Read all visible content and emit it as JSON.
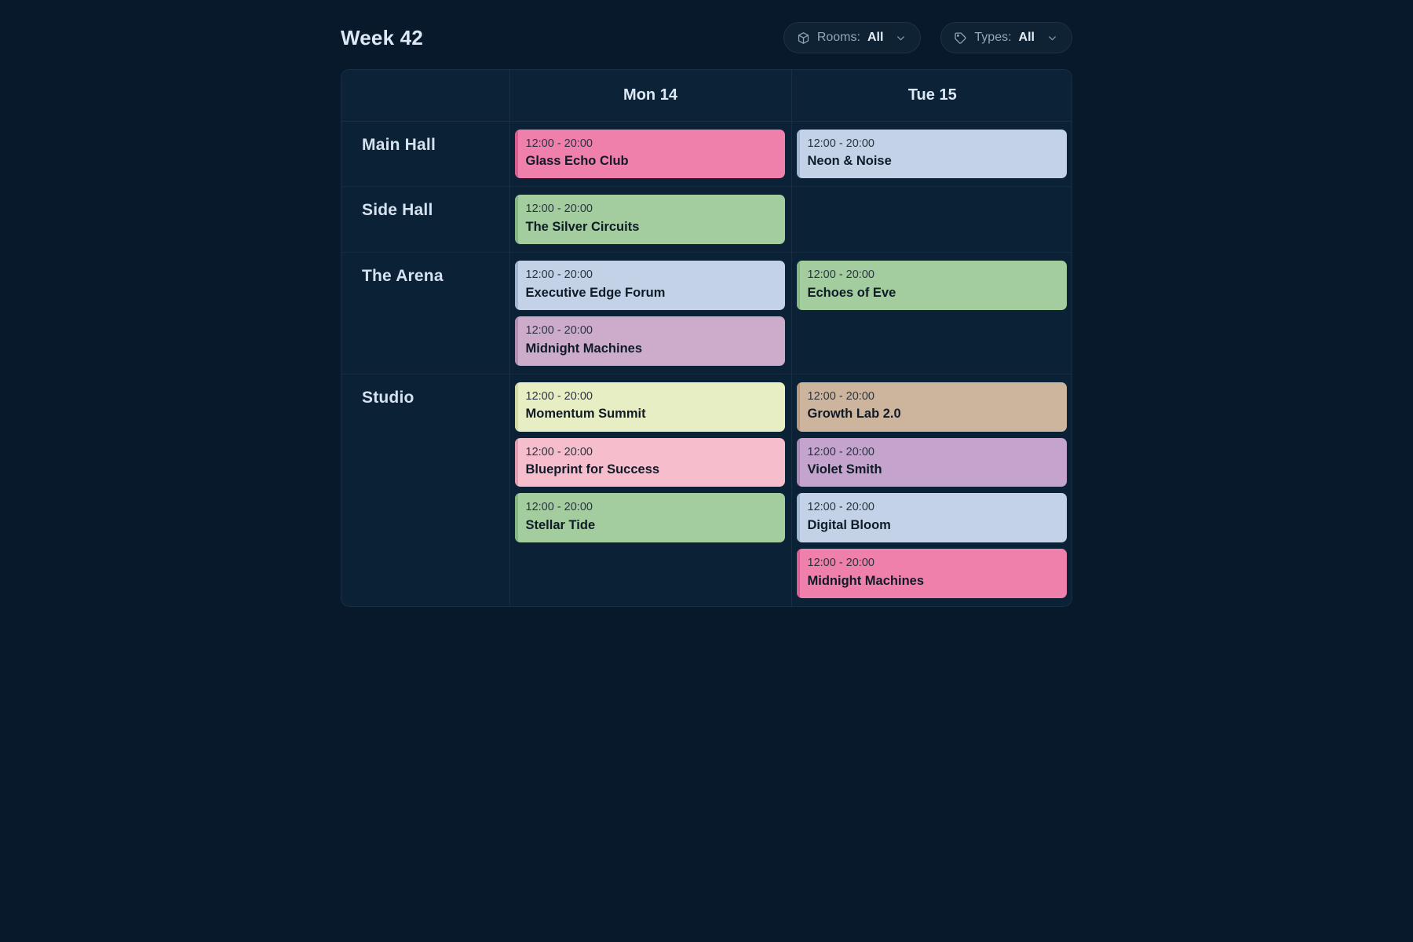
{
  "header": {
    "title": "Week 42",
    "filters": [
      {
        "icon": "cube-icon",
        "label": "Rooms:",
        "value": "All",
        "chevron": "chevron-down-icon"
      },
      {
        "icon": "tag-icon",
        "label": "Types:",
        "value": "All",
        "chevron": "chevron-down-icon"
      }
    ]
  },
  "schedule": {
    "columns": [
      "",
      "Mon 14",
      "Tue 15"
    ],
    "rows": [
      {
        "room": "Main Hall",
        "days": [
          [
            {
              "time": "12:00 - 20:00",
              "title": "Glass Echo Club",
              "color": "#ef7fab",
              "accent": "#d75f91"
            }
          ],
          [
            {
              "time": "12:00 - 20:00",
              "title": "Neon & Noise",
              "color": "#c3d2e6",
              "accent": "#a3b6d0"
            }
          ]
        ]
      },
      {
        "room": "Side Hall",
        "days": [
          [
            {
              "time": "12:00 - 20:00",
              "title": "The Silver Circuits",
              "color": "#a3cd9e",
              "accent": "#86b782"
            }
          ],
          []
        ]
      },
      {
        "room": "The Arena",
        "days": [
          [
            {
              "time": "12:00 - 20:00",
              "title": "Executive Edge Forum",
              "color": "#c3d2e6",
              "accent": "#a3b6d0"
            },
            {
              "time": "12:00 - 20:00",
              "title": "Midnight Machines",
              "color": "#ccabcb",
              "accent": "#b48fb4"
            }
          ],
          [
            {
              "time": "12:00 - 20:00",
              "title": "Echoes of Eve",
              "color": "#a3cd9e",
              "accent": "#86b782"
            }
          ]
        ]
      },
      {
        "room": "Studio",
        "days": [
          [
            {
              "time": "12:00 - 20:00",
              "title": "Momentum Summit",
              "color": "#e8eec4",
              "accent": "#d2dba4"
            },
            {
              "time": "12:00 - 20:00",
              "title": "Blueprint for Success",
              "color": "#f6bdcd",
              "accent": "#e39db2"
            },
            {
              "time": "12:00 - 20:00",
              "title": "Stellar Tide",
              "color": "#a3cd9e",
              "accent": "#86b782"
            }
          ],
          [
            {
              "time": "12:00 - 20:00",
              "title": "Growth Lab 2.0",
              "color": "#cdb49d",
              "accent": "#b59a80"
            },
            {
              "time": "12:00 - 20:00",
              "title": "Violet Smith",
              "color": "#c4a3cd",
              "accent": "#ab87b5"
            },
            {
              "time": "12:00 - 20:00",
              "title": "Digital Bloom",
              "color": "#c3d2e6",
              "accent": "#a3b6d0"
            },
            {
              "time": "12:00 - 20:00",
              "title": "Midnight Machines",
              "color": "#ef7fab",
              "accent": "#d75f91"
            }
          ]
        ]
      }
    ]
  },
  "colors": {
    "page_background": "#07192b",
    "panel_background": "#0b2136",
    "grid_line": "#1b2f44",
    "text_primary": "#dce8f5",
    "text_muted": "#93a6ba"
  }
}
